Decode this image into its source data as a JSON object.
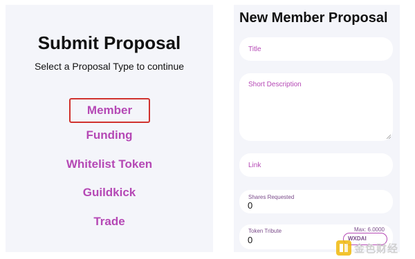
{
  "submit_panel": {
    "title": "Submit Proposal",
    "subtitle": "Select a Proposal Type to continue",
    "proposal_types": [
      "Member",
      "Funding",
      "Whitelist Token",
      "Guildkick",
      "Trade"
    ],
    "selected_type": "Member"
  },
  "member_form": {
    "title": "New Member Proposal",
    "title_placeholder": "Title",
    "short_description_placeholder": "Short Description",
    "link_placeholder": "Link",
    "shares_requested_label": "Shares Requested",
    "shares_requested_value": "0",
    "token_tribute_label": "Token Tribute",
    "token_tribute_value": "0",
    "max_label": "Max: 6.0000",
    "token_symbol": "WXDAI"
  },
  "watermark": {
    "text": "金色财经"
  },
  "colors": {
    "accent": "#b548b5",
    "selection_border": "#d0312d",
    "panel_bg": "#f4f5fa"
  }
}
